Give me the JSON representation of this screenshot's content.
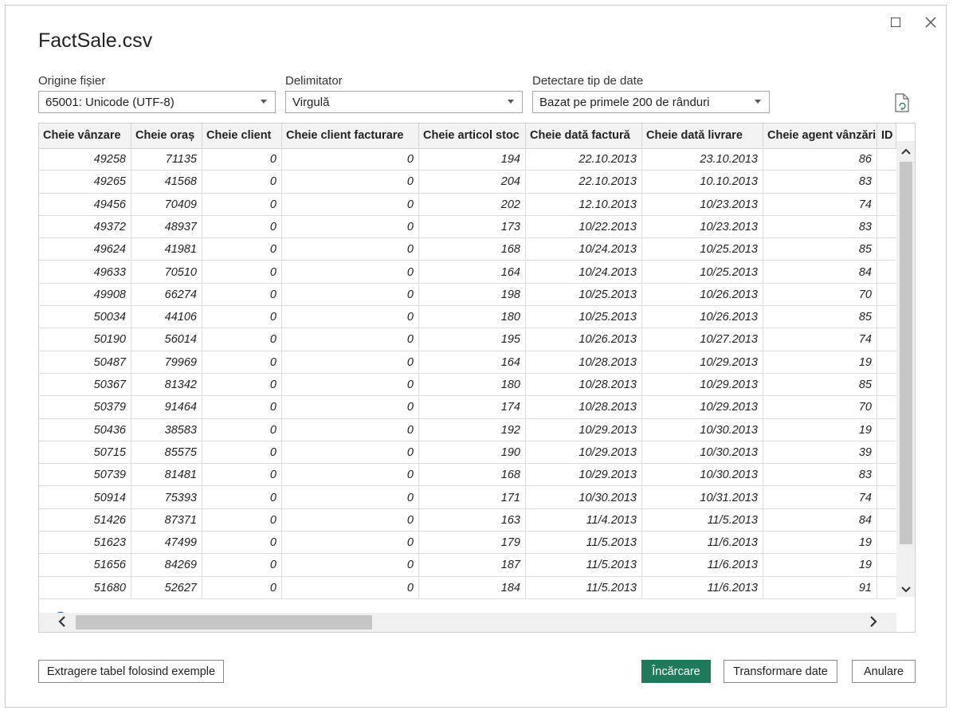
{
  "window": {
    "title": "FactSale.csv"
  },
  "options": {
    "file_origin": {
      "label": "Origine fișier",
      "value": "65001: Unicode (UTF-8)"
    },
    "delimiter": {
      "label": "Delimitator",
      "value": "Virgulă"
    },
    "data_type_detection": {
      "label": "Detectare tip de date",
      "value": "Bazat pe primele 200 de rânduri"
    }
  },
  "table": {
    "columns": [
      "Cheie vânzare",
      "Cheie oraș",
      "Cheie client",
      "Cheie client facturare",
      "Cheie articol stoc",
      "Cheie dată factură",
      "Cheie dată livrare",
      "Cheie agent vânzări",
      "ID"
    ],
    "rows": [
      [
        "49258",
        "71135",
        "0",
        "0",
        "194",
        "22.10.2013",
        "23.10.2013",
        "86"
      ],
      [
        "49265",
        "41568",
        "0",
        "0",
        "204",
        "22.10.2013",
        "10.10.2013",
        "83"
      ],
      [
        "49456",
        "70409",
        "0",
        "0",
        "202",
        "12.10.2013",
        "10/23.2013",
        "74"
      ],
      [
        "49372",
        "48937",
        "0",
        "0",
        "173",
        "10/22.2013",
        "10/23.2013",
        "83"
      ],
      [
        "49624",
        "41981",
        "0",
        "0",
        "168",
        "10/24.2013",
        "10/25.2013",
        "85"
      ],
      [
        "49633",
        "70510",
        "0",
        "0",
        "164",
        "10/24.2013",
        "10/25.2013",
        "84"
      ],
      [
        "49908",
        "66274",
        "0",
        "0",
        "198",
        "10/25.2013",
        "10/26.2013",
        "70"
      ],
      [
        "50034",
        "44106",
        "0",
        "0",
        "180",
        "10/25.2013",
        "10/26.2013",
        "85"
      ],
      [
        "50190",
        "56014",
        "0",
        "0",
        "195",
        "10/26.2013",
        "10/27.2013",
        "74"
      ],
      [
        "50487",
        "79969",
        "0",
        "0",
        "164",
        "10/28.2013",
        "10/29.2013",
        "19"
      ],
      [
        "50367",
        "81342",
        "0",
        "0",
        "180",
        "10/28.2013",
        "10/29.2013",
        "85"
      ],
      [
        "50379",
        "91464",
        "0",
        "0",
        "174",
        "10/28.2013",
        "10/29.2013",
        "70"
      ],
      [
        "50436",
        "38583",
        "0",
        "0",
        "192",
        "10/29.2013",
        "10/30.2013",
        "19"
      ],
      [
        "50715",
        "85575",
        "0",
        "0",
        "190",
        "10/29.2013",
        "10/30.2013",
        "39"
      ],
      [
        "50739",
        "81481",
        "0",
        "0",
        "168",
        "10/29.2013",
        "10/30.2013",
        "83"
      ],
      [
        "50914",
        "75393",
        "0",
        "0",
        "171",
        "10/30.2013",
        "10/31.2013",
        "74"
      ],
      [
        "51426",
        "87371",
        "0",
        "0",
        "163",
        "11/4.2013",
        "11/5.2013",
        "84"
      ],
      [
        "51623",
        "47499",
        "0",
        "0",
        "179",
        "11/5.2013",
        "11/6.2013",
        "19"
      ],
      [
        "51656",
        "84269",
        "0",
        "0",
        "187",
        "11/5.2013",
        "11/6.2013",
        "19"
      ],
      [
        "51680",
        "52627",
        "0",
        "0",
        "184",
        "11/5.2013",
        "11/6.2013",
        "91"
      ]
    ]
  },
  "footer": {
    "extract_label": "Extragere tabel folosind exemple",
    "load_label": "Încărcare",
    "transform_label": "Transformare date",
    "cancel_label": "Anulare"
  },
  "icons": {
    "maximize": "maximize-icon",
    "close": "close-icon",
    "refresh": "refresh-file-icon",
    "scroll_up": "chevron-up-icon",
    "scroll_down": "chevron-down-icon",
    "scroll_left": "chevron-left-icon",
    "scroll_right": "chevron-right-icon",
    "loading": "loading-spinner-icon"
  },
  "colors": {
    "primary": "#1f7a5c"
  }
}
